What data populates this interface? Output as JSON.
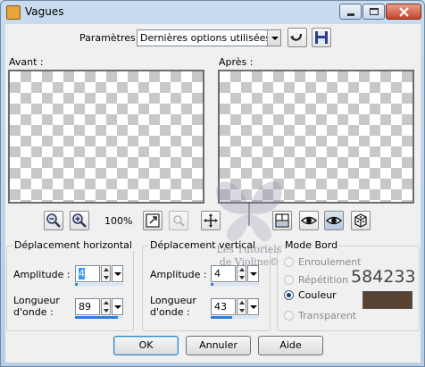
{
  "window": {
    "title": "Vagues"
  },
  "params": {
    "label": "Paramètres :",
    "preset": "Dernières options utilisées"
  },
  "preview": {
    "before_label": "Avant :",
    "after_label": "Après :"
  },
  "zoom": {
    "level": "100%"
  },
  "horizontal": {
    "title": "Déplacement horizontal",
    "amplitude_label": "Amplitude :",
    "amplitude_value": "4",
    "wavelength_label": "Longueur\nd'onde :",
    "wavelength_value": "89"
  },
  "vertical": {
    "title": "Déplacement vertical",
    "amplitude_label": "Amplitude :",
    "amplitude_value": "4",
    "wavelength_label": "Longueur\nd'onde :",
    "wavelength_value": "43"
  },
  "edge": {
    "title": "Mode Bord",
    "options": [
      "Enroulement",
      "Répétition",
      "Couleur",
      "Transparent"
    ],
    "selected": "Couleur",
    "color_hex": "584233",
    "color": "#584233"
  },
  "buttons": {
    "ok": "OK",
    "cancel": "Annuler",
    "help": "Aide"
  },
  "watermark": {
    "line1": "Les Tutoriels",
    "line2": "de Violine©"
  }
}
